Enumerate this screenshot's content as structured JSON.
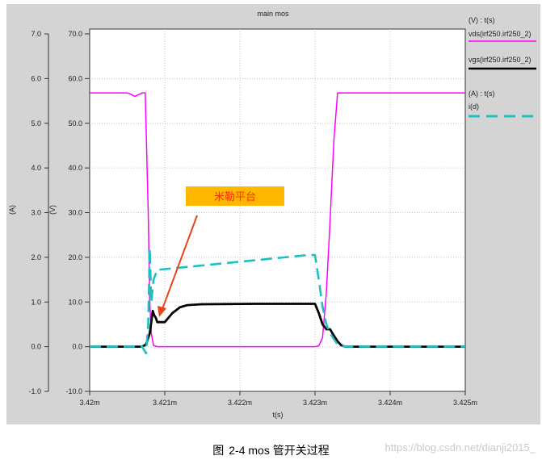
{
  "chart_data": {
    "type": "line",
    "title": "main mos",
    "xlabel": "t(s)",
    "xlim": [
      3.42,
      3.425
    ],
    "x_ticks": [
      "3.42m",
      "3.421m",
      "3.422m",
      "3.423m",
      "3.424m",
      "3.425m"
    ],
    "left_axis_A": {
      "label": "(A)",
      "range": [
        -1.0,
        7.0
      ],
      "ticks": [
        "7.0",
        "6.0",
        "5.0",
        "4.0",
        "3.0",
        "2.0",
        "1.0",
        "0.0",
        "-1.0"
      ]
    },
    "left_axis_V": {
      "label": "(V)",
      "range": [
        -10.0,
        70.0
      ],
      "ticks": [
        "70.0",
        "60.0",
        "50.0",
        "40.0",
        "30.0",
        "20.0",
        "10.0",
        "0.0",
        "-10.0"
      ]
    },
    "legend": {
      "group_v": "(V) : t(s)",
      "group_a": "(A) : t(s)"
    },
    "series": [
      {
        "name": "vds(irf250.irf250_2)",
        "unit": "V",
        "color": "#ff00ff",
        "style": "solid",
        "points": [
          [
            3.42,
            56.8
          ],
          [
            3.4205,
            56.8
          ],
          [
            3.42055,
            56.5
          ],
          [
            3.4206,
            56.0
          ],
          [
            3.42065,
            56.4
          ],
          [
            3.4207,
            56.8
          ],
          [
            3.42074,
            56.8
          ],
          [
            3.42078,
            30
          ],
          [
            3.4208,
            10
          ],
          [
            3.42082,
            3
          ],
          [
            3.42085,
            0.3
          ],
          [
            3.4209,
            0
          ],
          [
            3.42095,
            0
          ],
          [
            3.421,
            0
          ],
          [
            3.4229,
            0
          ],
          [
            3.423,
            0
          ],
          [
            3.42305,
            0.2
          ],
          [
            3.4231,
            2
          ],
          [
            3.42315,
            12
          ],
          [
            3.4232,
            28
          ],
          [
            3.42325,
            46
          ],
          [
            3.4233,
            56.8
          ],
          [
            3.425,
            56.8
          ]
        ]
      },
      {
        "name": "vgs(irf250.irf250_2)",
        "unit": "V",
        "color": "#000000",
        "style": "solid",
        "points": [
          [
            3.42,
            0
          ],
          [
            3.4207,
            0
          ],
          [
            3.42075,
            0.5
          ],
          [
            3.42078,
            2
          ],
          [
            3.4208,
            3
          ],
          [
            3.42082,
            5.5
          ],
          [
            3.42084,
            8
          ],
          [
            3.42086,
            7
          ],
          [
            3.42088,
            6.5
          ],
          [
            3.4209,
            5.5
          ],
          [
            3.421,
            5.5
          ],
          [
            3.4211,
            7.5
          ],
          [
            3.4212,
            8.8
          ],
          [
            3.4213,
            9.3
          ],
          [
            3.4215,
            9.5
          ],
          [
            3.4222,
            9.6
          ],
          [
            3.4229,
            9.6
          ],
          [
            3.423,
            9.6
          ],
          [
            3.42305,
            7.5
          ],
          [
            3.4231,
            5
          ],
          [
            3.42315,
            3.9
          ],
          [
            3.4232,
            3.9
          ],
          [
            3.42325,
            2.5
          ],
          [
            3.4233,
            1.2
          ],
          [
            3.42335,
            0.3
          ],
          [
            3.4234,
            0
          ],
          [
            3.425,
            0
          ]
        ]
      },
      {
        "name": "i(d)",
        "unit": "A",
        "color": "#1fbfbf",
        "style": "dashed",
        "points": [
          [
            3.42,
            0
          ],
          [
            3.4207,
            0
          ],
          [
            3.42075,
            -0.15
          ],
          [
            3.42078,
            0.5
          ],
          [
            3.4208,
            2.2
          ],
          [
            3.42082,
            1.0
          ],
          [
            3.42085,
            1.5
          ],
          [
            3.4209,
            1.72
          ],
          [
            3.4229,
            2.05
          ],
          [
            3.423,
            2.05
          ],
          [
            3.42305,
            1.5
          ],
          [
            3.4231,
            0.9
          ],
          [
            3.42315,
            0.5
          ],
          [
            3.4232,
            0.3
          ],
          [
            3.4233,
            0.05
          ],
          [
            3.4234,
            0
          ],
          [
            3.425,
            0
          ]
        ]
      }
    ],
    "annotation": {
      "text": "米勒平台",
      "box_color": "#ffb800",
      "text_color": "#ff2a00",
      "arrow_color": "#e8441a",
      "points_to": [
        3.42089,
        5.4
      ]
    }
  },
  "caption": {
    "figure": "图",
    "text": "2-4 mos 管开关过程"
  },
  "watermark": "https://blog.csdn.net/dianji2015_"
}
